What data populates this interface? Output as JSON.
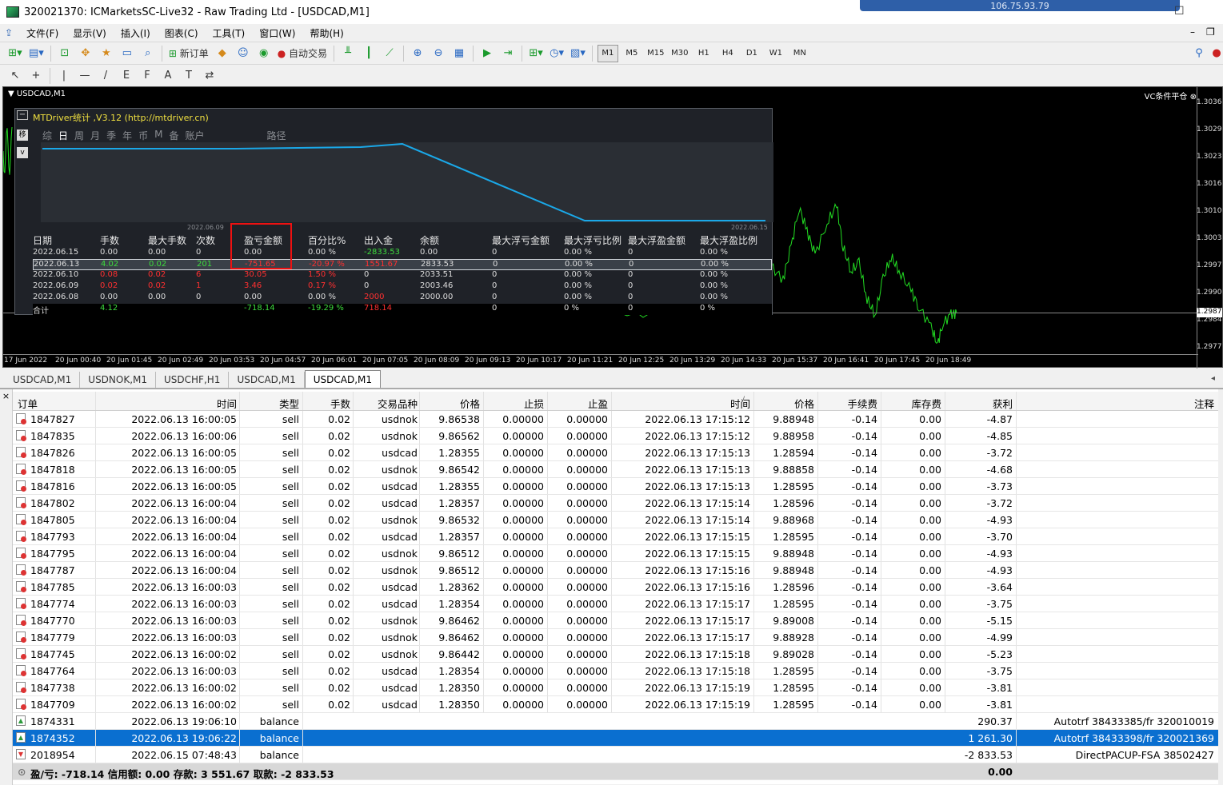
{
  "window": {
    "title": "320021370: ICMarketsSC-Live32 - Raw Trading Ltd - [USDCAD,M1]",
    "remote_ip": "106.75.93.79"
  },
  "menu": [
    "文件(F)",
    "显示(V)",
    "插入(I)",
    "图表(C)",
    "工具(T)",
    "窗口(W)",
    "帮助(H)"
  ],
  "toolbar": {
    "new_order": "新订单",
    "auto_trading": "自动交易",
    "timeframes": [
      "M1",
      "M5",
      "M15",
      "M30",
      "H1",
      "H4",
      "D1",
      "W1",
      "MN"
    ],
    "active_timeframe": "M1",
    "draw_tools": [
      "↖",
      "+",
      "|",
      "—",
      "/",
      "E",
      "F",
      "A",
      "T",
      "⇄"
    ]
  },
  "chart": {
    "label": "USDCAD,M1",
    "corner_label": "VC条件平仓",
    "price_ticks": [
      "1.3036",
      "1.3029",
      "1.3023",
      "1.3016",
      "1.3010",
      "1.3003",
      "1.2997",
      "1.2990",
      "1.2984",
      "1.2977"
    ],
    "current_price": "1.2987",
    "time_ticks": [
      "17 Jun 2022",
      "20 Jun 00:40",
      "20 Jun 01:45",
      "20 Jun 02:49",
      "20 Jun 03:53",
      "20 Jun 04:57",
      "20 Jun 06:01",
      "20 Jun 07:05",
      "20 Jun 08:09",
      "20 Jun 09:13",
      "20 Jun 10:17",
      "20 Jun 11:21",
      "20 Jun 12:25",
      "20 Jun 13:29",
      "20 Jun 14:33",
      "20 Jun 15:37",
      "20 Jun 16:41",
      "20 Jun 17:45",
      "20 Jun 18:49"
    ],
    "line_color": "#22dd22"
  },
  "mtdriver": {
    "title": "MTDriver统计 ,V3.12 (http://mtdriver.cn)",
    "collapse": "−",
    "side_buttons": [
      "移",
      "v"
    ],
    "tabs": [
      "综",
      "日",
      "周",
      "月",
      "季",
      "年",
      "币",
      "M",
      "备",
      "账户",
      "路径"
    ],
    "selected_tab": "日",
    "plot_dates": [
      "2022.06.09",
      "2022.06.15"
    ],
    "headers": [
      "日期",
      "手数",
      "最大手数",
      "次数",
      "盈亏金额",
      "百分比%",
      "出入金",
      "余额",
      "最大浮亏金额",
      "最大浮亏比例",
      "最大浮盈金额",
      "最大浮盈比例"
    ],
    "rows": [
      [
        "2022.06.15",
        "0.00",
        "0.00",
        "0",
        "0.00",
        "0.00 %",
        "-2833.53",
        "0.00",
        "0",
        "0.00 %",
        "0",
        "0.00 %"
      ],
      [
        "2022.06.13",
        "4.02",
        "0.02",
        "201",
        "-751.65",
        "-20.97 %",
        "1551.67",
        "2833.53",
        "0",
        "0.00 %",
        "0",
        "0.00 %"
      ],
      [
        "2022.06.10",
        "0.08",
        "0.02",
        "6",
        "30.05",
        "1.50 %",
        "0",
        "2033.51",
        "0",
        "0.00 %",
        "0",
        "0.00 %"
      ],
      [
        "2022.06.09",
        "0.02",
        "0.02",
        "1",
        "3.46",
        "0.17 %",
        "0",
        "2003.46",
        "0",
        "0.00 %",
        "0",
        "0.00 %"
      ],
      [
        "2022.06.08",
        "0.00",
        "0.00",
        "0",
        "0.00",
        "0.00 %",
        "2000",
        "2000.00",
        "0",
        "0.00 %",
        "0",
        "0.00 %"
      ]
    ],
    "total": [
      "合计",
      "4.12",
      "",
      "",
      "-718.14",
      "-19.29 %",
      "718.14",
      "",
      "0",
      "0 %",
      "0",
      "0 %"
    ],
    "equity_line_color": "#1aa8e8"
  },
  "chart_tabs": [
    "USDCAD,M1",
    "USDNOK,M1",
    "USDCHF,H1",
    "USDCAD,M1",
    "USDCAD,M1"
  ],
  "selected_chart_tab": 4,
  "terminal": {
    "close": "×",
    "columns": [
      "订单",
      "时间",
      "类型",
      "手数",
      "交易品种",
      "价格",
      "止损",
      "止盈",
      "时间",
      "价格",
      "手续费",
      "库存费",
      "获利",
      "注释"
    ],
    "sort_indicator": "/",
    "trades": [
      [
        "1847827",
        "2022.06.13 16:00:05",
        "sell",
        "0.02",
        "usdnok",
        "9.86538",
        "0.00000",
        "0.00000",
        "2022.06.13 17:15:12",
        "9.88948",
        "-0.14",
        "0.00",
        "-4.87"
      ],
      [
        "1847835",
        "2022.06.13 16:00:06",
        "sell",
        "0.02",
        "usdnok",
        "9.86562",
        "0.00000",
        "0.00000",
        "2022.06.13 17:15:12",
        "9.88958",
        "-0.14",
        "0.00",
        "-4.85"
      ],
      [
        "1847826",
        "2022.06.13 16:00:05",
        "sell",
        "0.02",
        "usdcad",
        "1.28355",
        "0.00000",
        "0.00000",
        "2022.06.13 17:15:13",
        "1.28594",
        "-0.14",
        "0.00",
        "-3.72"
      ],
      [
        "1847818",
        "2022.06.13 16:00:05",
        "sell",
        "0.02",
        "usdnok",
        "9.86542",
        "0.00000",
        "0.00000",
        "2022.06.13 17:15:13",
        "9.88858",
        "-0.14",
        "0.00",
        "-4.68"
      ],
      [
        "1847816",
        "2022.06.13 16:00:05",
        "sell",
        "0.02",
        "usdcad",
        "1.28355",
        "0.00000",
        "0.00000",
        "2022.06.13 17:15:13",
        "1.28595",
        "-0.14",
        "0.00",
        "-3.73"
      ],
      [
        "1847802",
        "2022.06.13 16:00:04",
        "sell",
        "0.02",
        "usdcad",
        "1.28357",
        "0.00000",
        "0.00000",
        "2022.06.13 17:15:14",
        "1.28596",
        "-0.14",
        "0.00",
        "-3.72"
      ],
      [
        "1847805",
        "2022.06.13 16:00:04",
        "sell",
        "0.02",
        "usdnok",
        "9.86532",
        "0.00000",
        "0.00000",
        "2022.06.13 17:15:14",
        "9.88968",
        "-0.14",
        "0.00",
        "-4.93"
      ],
      [
        "1847793",
        "2022.06.13 16:00:04",
        "sell",
        "0.02",
        "usdcad",
        "1.28357",
        "0.00000",
        "0.00000",
        "2022.06.13 17:15:15",
        "1.28595",
        "-0.14",
        "0.00",
        "-3.70"
      ],
      [
        "1847795",
        "2022.06.13 16:00:04",
        "sell",
        "0.02",
        "usdnok",
        "9.86512",
        "0.00000",
        "0.00000",
        "2022.06.13 17:15:15",
        "9.88948",
        "-0.14",
        "0.00",
        "-4.93"
      ],
      [
        "1847787",
        "2022.06.13 16:00:04",
        "sell",
        "0.02",
        "usdnok",
        "9.86512",
        "0.00000",
        "0.00000",
        "2022.06.13 17:15:16",
        "9.88948",
        "-0.14",
        "0.00",
        "-4.93"
      ],
      [
        "1847785",
        "2022.06.13 16:00:03",
        "sell",
        "0.02",
        "usdcad",
        "1.28362",
        "0.00000",
        "0.00000",
        "2022.06.13 17:15:16",
        "1.28596",
        "-0.14",
        "0.00",
        "-3.64"
      ],
      [
        "1847774",
        "2022.06.13 16:00:03",
        "sell",
        "0.02",
        "usdcad",
        "1.28354",
        "0.00000",
        "0.00000",
        "2022.06.13 17:15:17",
        "1.28595",
        "-0.14",
        "0.00",
        "-3.75"
      ],
      [
        "1847770",
        "2022.06.13 16:00:03",
        "sell",
        "0.02",
        "usdnok",
        "9.86462",
        "0.00000",
        "0.00000",
        "2022.06.13 17:15:17",
        "9.89008",
        "-0.14",
        "0.00",
        "-5.15"
      ],
      [
        "1847779",
        "2022.06.13 16:00:03",
        "sell",
        "0.02",
        "usdnok",
        "9.86462",
        "0.00000",
        "0.00000",
        "2022.06.13 17:15:17",
        "9.88928",
        "-0.14",
        "0.00",
        "-4.99"
      ],
      [
        "1847745",
        "2022.06.13 16:00:02",
        "sell",
        "0.02",
        "usdnok",
        "9.86442",
        "0.00000",
        "0.00000",
        "2022.06.13 17:15:18",
        "9.89028",
        "-0.14",
        "0.00",
        "-5.23"
      ],
      [
        "1847764",
        "2022.06.13 16:00:03",
        "sell",
        "0.02",
        "usdcad",
        "1.28354",
        "0.00000",
        "0.00000",
        "2022.06.13 17:15:18",
        "1.28595",
        "-0.14",
        "0.00",
        "-3.75"
      ],
      [
        "1847738",
        "2022.06.13 16:00:02",
        "sell",
        "0.02",
        "usdcad",
        "1.28350",
        "0.00000",
        "0.00000",
        "2022.06.13 17:15:19",
        "1.28595",
        "-0.14",
        "0.00",
        "-3.81"
      ],
      [
        "1847709",
        "2022.06.13 16:00:02",
        "sell",
        "0.02",
        "usdcad",
        "1.28350",
        "0.00000",
        "0.00000",
        "2022.06.13 17:15:19",
        "1.28595",
        "-0.14",
        "0.00",
        "-3.81"
      ]
    ],
    "balances": [
      {
        "order": "1874331",
        "time": "2022.06.13 19:06:10",
        "type": "balance",
        "profit": "290.37",
        "comment": "Autotrf 38433385/fr 320010019",
        "dir": "in"
      },
      {
        "order": "1874352",
        "time": "2022.06.13 19:06:22",
        "type": "balance",
        "profit": "1 261.30",
        "comment": "Autotrf 38433398/fr 320021369",
        "dir": "in",
        "selected": true
      },
      {
        "order": "2018954",
        "time": "2022.06.15 07:48:43",
        "type": "balance",
        "profit": "-2 833.53",
        "comment": "DirectPACUP-FSA 38502427",
        "dir": "out"
      }
    ],
    "summary": "盈/亏: -718.14  信用额: 0.00  存款: 3 551.67  取款: -2 833.53",
    "summary_total": "0.00"
  }
}
